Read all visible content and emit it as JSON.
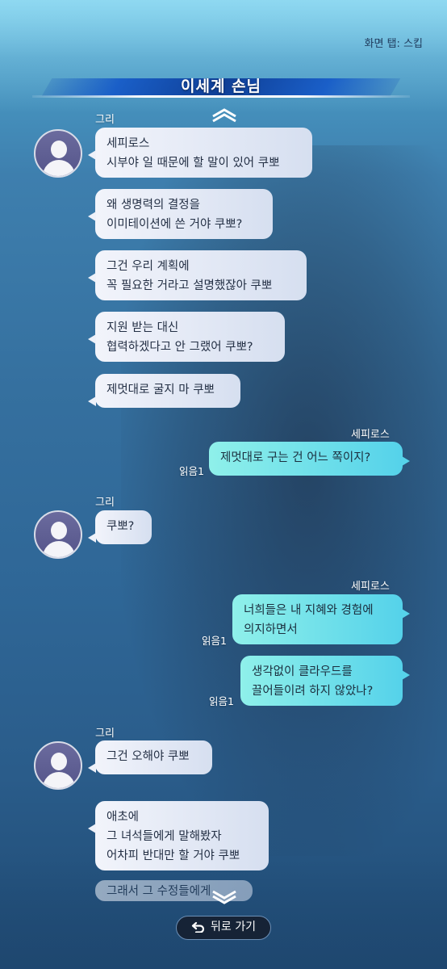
{
  "header": {
    "screen_tap": "화면 탭: 스킵",
    "title": "이세계 손님"
  },
  "messages": [
    {
      "name": "그리",
      "lines": "세피로스\n시부야 일 때문에 할 말이 있어 쿠뽀"
    },
    {
      "lines": "왜 생명력의 결정을\n이미테이션에 쓴 거야 쿠뽀?"
    },
    {
      "lines": "그건 우리 계획에\n꼭 필요한 거라고 설명했잖아 쿠뽀"
    },
    {
      "lines": "지원 받는 대신\n협력하겠다고 안 그랬어 쿠뽀?"
    },
    {
      "lines": "제멋대로 굴지 마 쿠뽀"
    },
    {
      "name": "세피로스",
      "read": "읽음1",
      "lines": "제멋대로 구는 건 어느 쪽이지?"
    },
    {
      "name": "그리",
      "lines": "쿠뽀?"
    },
    {
      "name": "세피로스",
      "read": "읽음1",
      "lines": "너희들은 내 지혜와 경험에\n의지하면서"
    },
    {
      "read": "읽음1",
      "lines": "생각없이 클라우드를\n끌어들이려 하지 않았나?"
    },
    {
      "name": "그리",
      "lines": "그건 오해야 쿠뽀"
    },
    {
      "lines": "애초에\n그 녀석들에게 말해봤자\n어차피 반대만 할 거야 쿠뽀"
    },
    {
      "lines": "그래서 그 수정들에게"
    }
  ],
  "footer": {
    "back_label": "뒤로 가기"
  },
  "icons": {
    "scroll_up": "chevron-up-icon",
    "scroll_down": "chevron-down-icon",
    "back": "undo-arrow-icon",
    "avatar": "user-silhouette-icon"
  },
  "colors": {
    "title_banner": "#1a5fc8",
    "bubble_left": "#e8edf7",
    "bubble_right": "#6ee0ea",
    "back_button": "#162336"
  }
}
